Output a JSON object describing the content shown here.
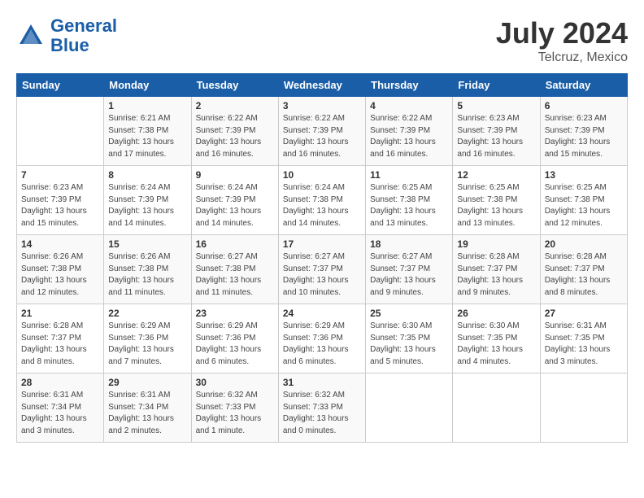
{
  "header": {
    "logo_line1": "General",
    "logo_line2": "Blue",
    "month_year": "July 2024",
    "location": "Telcruz, Mexico"
  },
  "days_of_week": [
    "Sunday",
    "Monday",
    "Tuesday",
    "Wednesday",
    "Thursday",
    "Friday",
    "Saturday"
  ],
  "weeks": [
    [
      {
        "day": "",
        "info": ""
      },
      {
        "day": "1",
        "info": "Sunrise: 6:21 AM\nSunset: 7:38 PM\nDaylight: 13 hours\nand 17 minutes."
      },
      {
        "day": "2",
        "info": "Sunrise: 6:22 AM\nSunset: 7:39 PM\nDaylight: 13 hours\nand 16 minutes."
      },
      {
        "day": "3",
        "info": "Sunrise: 6:22 AM\nSunset: 7:39 PM\nDaylight: 13 hours\nand 16 minutes."
      },
      {
        "day": "4",
        "info": "Sunrise: 6:22 AM\nSunset: 7:39 PM\nDaylight: 13 hours\nand 16 minutes."
      },
      {
        "day": "5",
        "info": "Sunrise: 6:23 AM\nSunset: 7:39 PM\nDaylight: 13 hours\nand 16 minutes."
      },
      {
        "day": "6",
        "info": "Sunrise: 6:23 AM\nSunset: 7:39 PM\nDaylight: 13 hours\nand 15 minutes."
      }
    ],
    [
      {
        "day": "7",
        "info": "Sunrise: 6:23 AM\nSunset: 7:39 PM\nDaylight: 13 hours\nand 15 minutes."
      },
      {
        "day": "8",
        "info": "Sunrise: 6:24 AM\nSunset: 7:39 PM\nDaylight: 13 hours\nand 14 minutes."
      },
      {
        "day": "9",
        "info": "Sunrise: 6:24 AM\nSunset: 7:39 PM\nDaylight: 13 hours\nand 14 minutes."
      },
      {
        "day": "10",
        "info": "Sunrise: 6:24 AM\nSunset: 7:38 PM\nDaylight: 13 hours\nand 14 minutes."
      },
      {
        "day": "11",
        "info": "Sunrise: 6:25 AM\nSunset: 7:38 PM\nDaylight: 13 hours\nand 13 minutes."
      },
      {
        "day": "12",
        "info": "Sunrise: 6:25 AM\nSunset: 7:38 PM\nDaylight: 13 hours\nand 13 minutes."
      },
      {
        "day": "13",
        "info": "Sunrise: 6:25 AM\nSunset: 7:38 PM\nDaylight: 13 hours\nand 12 minutes."
      }
    ],
    [
      {
        "day": "14",
        "info": "Sunrise: 6:26 AM\nSunset: 7:38 PM\nDaylight: 13 hours\nand 12 minutes."
      },
      {
        "day": "15",
        "info": "Sunrise: 6:26 AM\nSunset: 7:38 PM\nDaylight: 13 hours\nand 11 minutes."
      },
      {
        "day": "16",
        "info": "Sunrise: 6:27 AM\nSunset: 7:38 PM\nDaylight: 13 hours\nand 11 minutes."
      },
      {
        "day": "17",
        "info": "Sunrise: 6:27 AM\nSunset: 7:37 PM\nDaylight: 13 hours\nand 10 minutes."
      },
      {
        "day": "18",
        "info": "Sunrise: 6:27 AM\nSunset: 7:37 PM\nDaylight: 13 hours\nand 9 minutes."
      },
      {
        "day": "19",
        "info": "Sunrise: 6:28 AM\nSunset: 7:37 PM\nDaylight: 13 hours\nand 9 minutes."
      },
      {
        "day": "20",
        "info": "Sunrise: 6:28 AM\nSunset: 7:37 PM\nDaylight: 13 hours\nand 8 minutes."
      }
    ],
    [
      {
        "day": "21",
        "info": "Sunrise: 6:28 AM\nSunset: 7:37 PM\nDaylight: 13 hours\nand 8 minutes."
      },
      {
        "day": "22",
        "info": "Sunrise: 6:29 AM\nSunset: 7:36 PM\nDaylight: 13 hours\nand 7 minutes."
      },
      {
        "day": "23",
        "info": "Sunrise: 6:29 AM\nSunset: 7:36 PM\nDaylight: 13 hours\nand 6 minutes."
      },
      {
        "day": "24",
        "info": "Sunrise: 6:29 AM\nSunset: 7:36 PM\nDaylight: 13 hours\nand 6 minutes."
      },
      {
        "day": "25",
        "info": "Sunrise: 6:30 AM\nSunset: 7:35 PM\nDaylight: 13 hours\nand 5 minutes."
      },
      {
        "day": "26",
        "info": "Sunrise: 6:30 AM\nSunset: 7:35 PM\nDaylight: 13 hours\nand 4 minutes."
      },
      {
        "day": "27",
        "info": "Sunrise: 6:31 AM\nSunset: 7:35 PM\nDaylight: 13 hours\nand 3 minutes."
      }
    ],
    [
      {
        "day": "28",
        "info": "Sunrise: 6:31 AM\nSunset: 7:34 PM\nDaylight: 13 hours\nand 3 minutes."
      },
      {
        "day": "29",
        "info": "Sunrise: 6:31 AM\nSunset: 7:34 PM\nDaylight: 13 hours\nand 2 minutes."
      },
      {
        "day": "30",
        "info": "Sunrise: 6:32 AM\nSunset: 7:33 PM\nDaylight: 13 hours\nand 1 minute."
      },
      {
        "day": "31",
        "info": "Sunrise: 6:32 AM\nSunset: 7:33 PM\nDaylight: 13 hours\nand 0 minutes."
      },
      {
        "day": "",
        "info": ""
      },
      {
        "day": "",
        "info": ""
      },
      {
        "day": "",
        "info": ""
      }
    ]
  ]
}
